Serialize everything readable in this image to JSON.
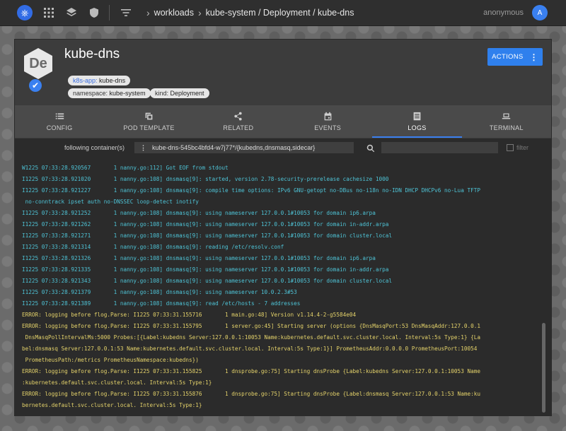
{
  "topbar": {
    "logo_icon": "kubernetes-icon",
    "breadcrumb_root": "workloads",
    "breadcrumb_path": "kube-system / Deployment / kube-dns",
    "user_name": "anonymous",
    "user_initial": "A"
  },
  "resource": {
    "badge": "De",
    "name": "kube-dns",
    "labels": [
      {
        "key": "k8s-app:",
        "value": "kube-dns"
      },
      {
        "key": "namespace:",
        "value": "kube-system"
      },
      {
        "key": "kind:",
        "value": "Deployment"
      }
    ],
    "actions_label": "ACTIONS"
  },
  "tabs": [
    {
      "label": "CONFIG",
      "icon": "list-icon"
    },
    {
      "label": "POD TEMPLATE",
      "icon": "template-icon"
    },
    {
      "label": "RELATED",
      "icon": "share-icon"
    },
    {
      "label": "EVENTS",
      "icon": "calendar-icon"
    },
    {
      "label": "LOGS",
      "icon": "logs-icon",
      "active": true
    },
    {
      "label": "TERMINAL",
      "icon": "laptop-icon"
    }
  ],
  "logbar": {
    "following_label": "following container(s)",
    "container_value": "kube-dns-545bc4bfd4-w7j77*/{kubedns,dnsmasq,sidecar}",
    "filter_label": "filter"
  },
  "logs": [
    {
      "kind": "info",
      "text": "W1225 07:33:28.920567       1 nanny.go:112] Got EOF from stdout"
    },
    {
      "kind": "info",
      "text": "I1225 07:33:28.921020       1 nanny.go:108] dnsmasq[9]: started, version 2.78-security-prerelease cachesize 1000"
    },
    {
      "kind": "info",
      "text": "I1225 07:33:28.921227       1 nanny.go:108] dnsmasq[9]: compile time options: IPv6 GNU-getopt no-DBus no-i18n no-IDN DHCP DHCPv6 no-Lua TFTP"
    },
    {
      "kind": "info",
      "text": " no-conntrack ipset auth no-DNSSEC loop-detect inotify"
    },
    {
      "kind": "info",
      "text": "I1225 07:33:28.921252       1 nanny.go:108] dnsmasq[9]: using nameserver 127.0.0.1#10053 for domain ip6.arpa"
    },
    {
      "kind": "info",
      "text": "I1225 07:33:28.921262       1 nanny.go:108] dnsmasq[9]: using nameserver 127.0.0.1#10053 for domain in-addr.arpa"
    },
    {
      "kind": "info",
      "text": "I1225 07:33:28.921271       1 nanny.go:108] dnsmasq[9]: using nameserver 127.0.0.1#10053 for domain cluster.local"
    },
    {
      "kind": "info",
      "text": "I1225 07:33:28.921314       1 nanny.go:108] dnsmasq[9]: reading /etc/resolv.conf"
    },
    {
      "kind": "info",
      "text": "I1225 07:33:28.921326       1 nanny.go:108] dnsmasq[9]: using nameserver 127.0.0.1#10053 for domain ip6.arpa"
    },
    {
      "kind": "info",
      "text": "I1225 07:33:28.921335       1 nanny.go:108] dnsmasq[9]: using nameserver 127.0.0.1#10053 for domain in-addr.arpa"
    },
    {
      "kind": "info",
      "text": "I1225 07:33:28.921343       1 nanny.go:108] dnsmasq[9]: using nameserver 127.0.0.1#10053 for domain cluster.local"
    },
    {
      "kind": "info",
      "text": "I1225 07:33:28.921379       1 nanny.go:108] dnsmasq[9]: using nameserver 10.0.2.3#53"
    },
    {
      "kind": "info",
      "text": "I1225 07:33:28.921389       1 nanny.go:108] dnsmasq[9]: read /etc/hosts - 7 addresses"
    },
    {
      "kind": "err",
      "text": "ERROR: logging before flog.Parse: I1225 07:33:31.155716       1 main.go:48] Version v1.14.4-2-g5584e04"
    },
    {
      "kind": "err",
      "text": "ERROR: logging before flog.Parse: I1225 07:33:31.155795       1 server.go:45] Starting server (options {DnsMasqPort:53 DnsMasqAddr:127.0.0.1"
    },
    {
      "kind": "err",
      "text": " DnsMasqPollIntervalMs:5000 Probes:[{Label:kubedns Server:127.0.0.1:10053 Name:kubernetes.default.svc.cluster.local. Interval:5s Type:1} {La"
    },
    {
      "kind": "err",
      "text": "bel:dnsmasq Server:127.0.0.1:53 Name:kubernetes.default.svc.cluster.local. Interval:5s Type:1}] PrometheusAddr:0.0.0.0 PrometheusPort:10054"
    },
    {
      "kind": "err",
      "text": " PrometheusPath:/metrics PrometheusNamespace:kubedns})"
    },
    {
      "kind": "err",
      "text": "ERROR: logging before flog.Parse: I1225 07:33:31.155825       1 dnsprobe.go:75] Starting dnsProbe {Label:kubedns Server:127.0.0.1:10053 Name"
    },
    {
      "kind": "err",
      "text": ":kubernetes.default.svc.cluster.local. Interval:5s Type:1}"
    },
    {
      "kind": "err",
      "text": "ERROR: logging before flog.Parse: I1225 07:33:31.155876       1 dnsprobe.go:75] Starting dnsProbe {Label:dnsmasq Server:127.0.0.1:53 Name:ku"
    },
    {
      "kind": "err",
      "text": "bernetes.default.svc.cluster.local. Interval:5s Type:1}"
    }
  ]
}
